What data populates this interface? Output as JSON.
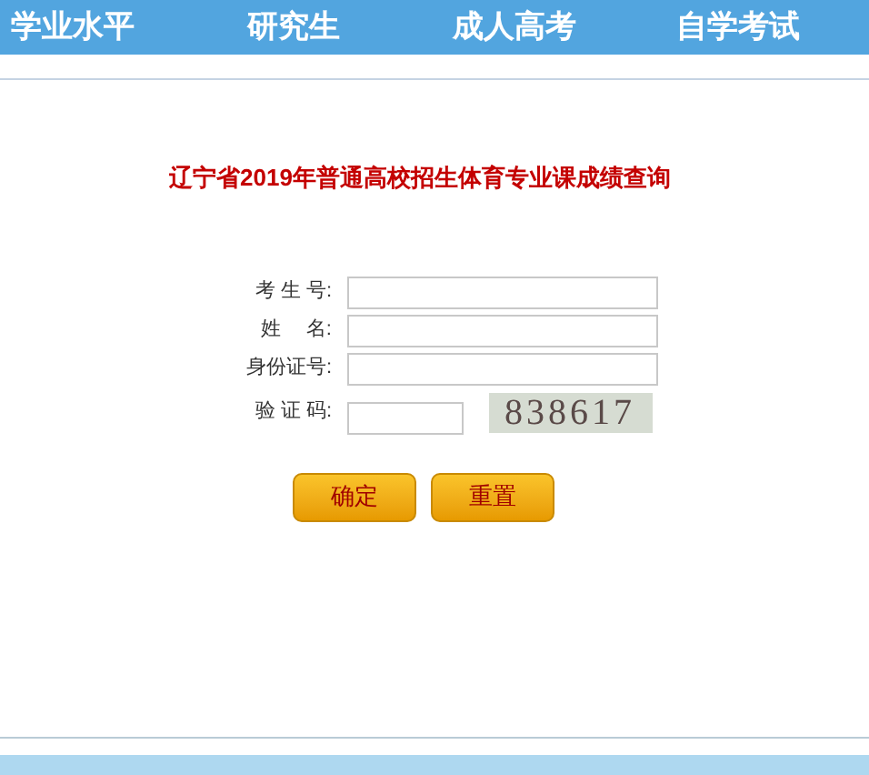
{
  "nav": [
    {
      "label": "学业水平"
    },
    {
      "label": "研究生"
    },
    {
      "label": "成人高考"
    },
    {
      "label": "自学考试"
    }
  ],
  "title": "辽宁省2019年普通高校招生体育专业课成绩查询",
  "form": {
    "fields": [
      {
        "label": "考 生 号:",
        "kind": "text"
      },
      {
        "label": "姓　 名:",
        "kind": "text"
      },
      {
        "label": "身份证号:",
        "kind": "text"
      },
      {
        "label": "验 证 码:",
        "kind": "captcha",
        "captcha": "838617"
      }
    ],
    "buttons": [
      "确定",
      "重置"
    ]
  }
}
